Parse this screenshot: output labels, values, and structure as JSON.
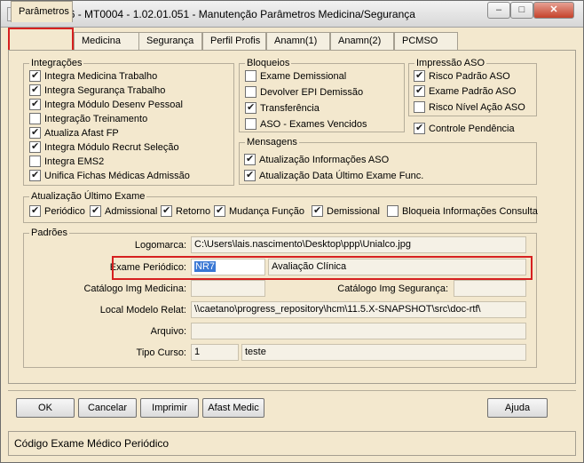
{
  "window": {
    "title": "06.9.5596 - MT0004 - 1.02.01.051 - Manutenção Parâmetros Medicina/Segurança",
    "minimize": "–",
    "maximize": "□",
    "close": "✕"
  },
  "tabs": [
    {
      "label": "Parâmetros"
    },
    {
      "label": "Medicina"
    },
    {
      "label": "Segurança"
    },
    {
      "label": "Perfil Profis"
    },
    {
      "label": "Anamn(1)"
    },
    {
      "label": "Anamn(2)"
    },
    {
      "label": "PCMSO"
    }
  ],
  "integracoes": {
    "title": "Integrações",
    "items": [
      {
        "label": "Integra Medicina Trabalho",
        "checked": true
      },
      {
        "label": "Integra Segurança Trabalho",
        "checked": true
      },
      {
        "label": "Integra Módulo Desenv Pessoal",
        "checked": true
      },
      {
        "label": "Integração Treinamento",
        "checked": false
      },
      {
        "label": "Atualiza Afast FP",
        "checked": true
      },
      {
        "label": "Integra Módulo Recrut Seleção",
        "checked": true
      },
      {
        "label": "Integra EMS2",
        "checked": false
      },
      {
        "label": "Unifica Fichas Médicas Admissão",
        "checked": true
      }
    ]
  },
  "bloqueios": {
    "title": "Bloqueios",
    "items": [
      {
        "label": "Exame Demissional",
        "checked": false
      },
      {
        "label": "Devolver EPI Demissão",
        "checked": false
      },
      {
        "label": "Transferência",
        "checked": true
      },
      {
        "label": "ASO - Exames Vencidos",
        "checked": false
      }
    ]
  },
  "impressao": {
    "title": "Impressão ASO",
    "items": [
      {
        "label": "Risco Padrão ASO",
        "checked": true
      },
      {
        "label": "Exame Padrão ASO",
        "checked": true
      },
      {
        "label": "Risco Nível Ação ASO",
        "checked": false
      }
    ]
  },
  "controle_pendencia": {
    "label": "Controle Pendência",
    "checked": true
  },
  "mensagens": {
    "title": "Mensagens",
    "items": [
      {
        "label": "Atualização Informações ASO",
        "checked": true
      },
      {
        "label": "Atualização Data Último Exame Func.",
        "checked": true
      }
    ]
  },
  "atualizacao": {
    "title": "Atualização Último Exame",
    "items": [
      {
        "label": "Periódico",
        "checked": true
      },
      {
        "label": "Admissional",
        "checked": true
      },
      {
        "label": "Retorno",
        "checked": true
      },
      {
        "label": "Mudança Função",
        "checked": true
      },
      {
        "label": "Demissional",
        "checked": true
      },
      {
        "label": "Bloqueia Informações Consulta",
        "checked": false
      }
    ]
  },
  "padroes": {
    "title": "Padrões",
    "logomarca_label": "Logomarca:",
    "logomarca_value": "C:\\Users\\lais.nascimento\\Desktop\\ppp\\Unialco.jpg",
    "exame_label": "Exame Periódico:",
    "exame_code": "NR7",
    "exame_desc": "Avaliação Clínica",
    "catalogo_med_label": "Catálogo Img Medicina:",
    "catalogo_med_value": "",
    "catalogo_seg_label": "Catálogo Img Segurança:",
    "catalogo_seg_value": "",
    "modelo_label": "Local Modelo Relat:",
    "modelo_value": "\\\\caetano\\progress_repository\\hcm\\11.5.X-SNAPSHOT\\src\\doc-rtf\\",
    "arquivo_label": "Arquivo:",
    "arquivo_value": "",
    "tipo_curso_label": "Tipo Curso:",
    "tipo_curso_code": "1",
    "tipo_curso_desc": "teste"
  },
  "buttons": {
    "ok": "OK",
    "cancelar": "Cancelar",
    "imprimir": "Imprimir",
    "afast_medic": "Afast Medic",
    "ajuda": "Ajuda"
  },
  "status": "Código Exame Médico Periódico",
  "colors": {
    "panel_bg": "#f3e8ce",
    "highlight": "#d62020",
    "selection": "#3a78d4"
  }
}
